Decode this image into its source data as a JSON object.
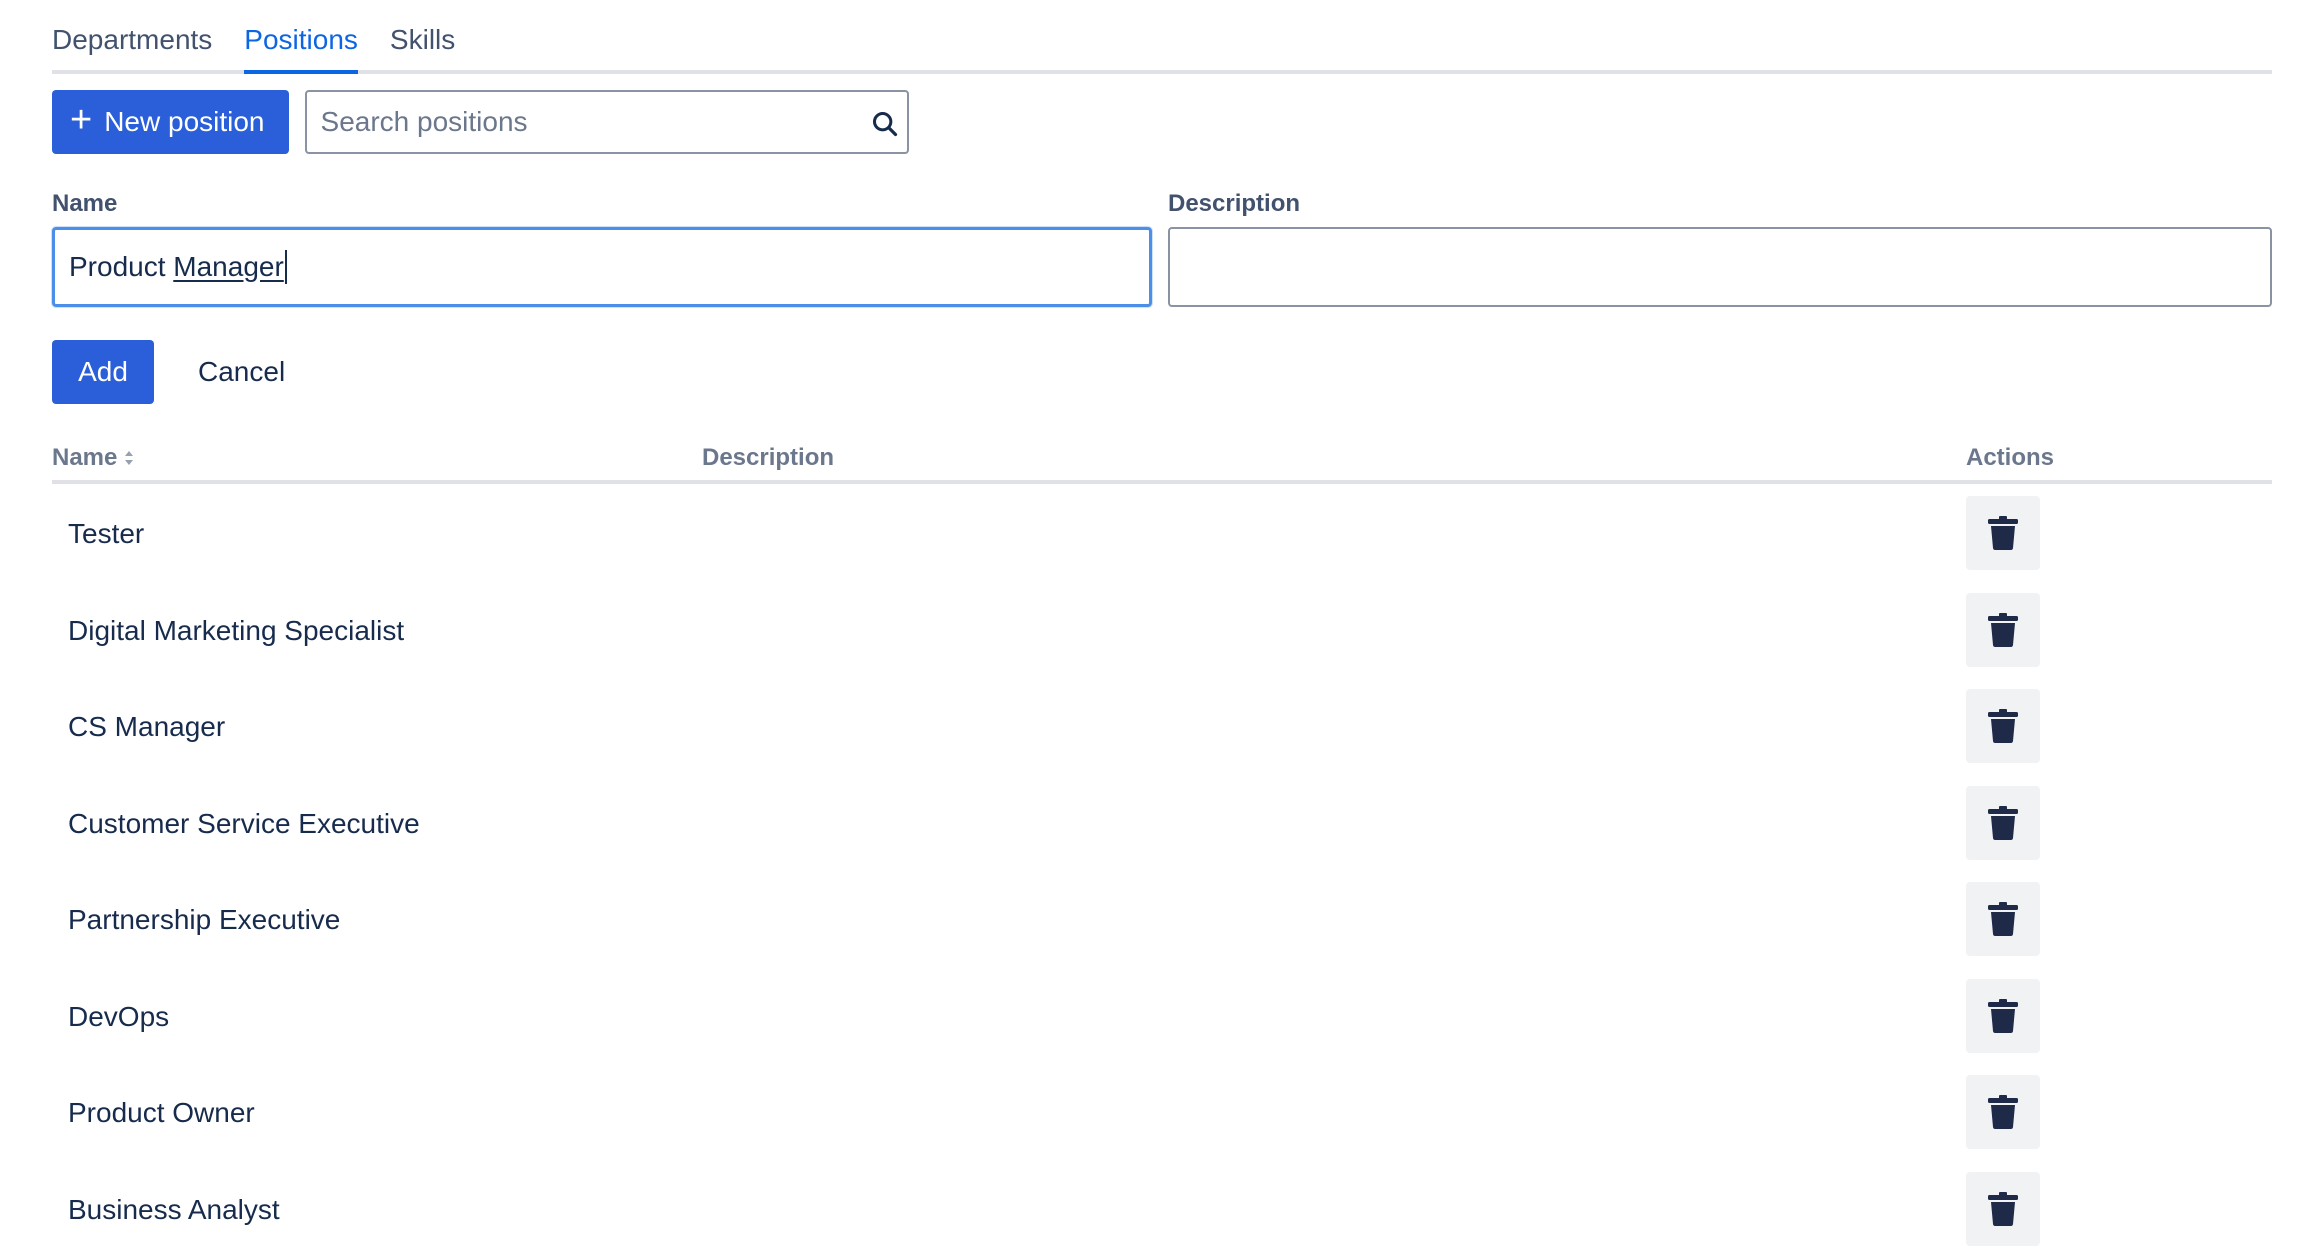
{
  "tabs": [
    {
      "label": "Departments",
      "active": false
    },
    {
      "label": "Positions",
      "active": true
    },
    {
      "label": "Skills",
      "active": false
    }
  ],
  "toolbar": {
    "new_button_label": "New position",
    "search_placeholder": "Search positions",
    "search_value": ""
  },
  "form": {
    "name_label": "Name",
    "name_value_prefix": "Product ",
    "name_value_word": "Manager",
    "description_label": "Description",
    "description_value": "",
    "add_label": "Add",
    "cancel_label": "Cancel"
  },
  "table": {
    "columns": {
      "name": "Name",
      "description": "Description",
      "actions": "Actions"
    },
    "rows": [
      {
        "name": "Tester",
        "description": ""
      },
      {
        "name": "Digital Marketing Specialist",
        "description": ""
      },
      {
        "name": "CS Manager",
        "description": ""
      },
      {
        "name": "Customer Service Executive",
        "description": ""
      },
      {
        "name": "Partnership Executive",
        "description": ""
      },
      {
        "name": "DevOps",
        "description": ""
      },
      {
        "name": "Product Owner",
        "description": ""
      },
      {
        "name": "Business Analyst",
        "description": ""
      }
    ]
  },
  "icons": {
    "new": "plus-icon",
    "search": "search-icon",
    "sort": "sort-icon",
    "delete": "trash-icon"
  },
  "colors": {
    "accent": "#2a5fd9",
    "active_tab": "#0c66e4",
    "text": "#172b4d",
    "muted": "#6b778c",
    "icon_dark": "#1e2a47",
    "button_subtle_bg": "#f1f2f4"
  }
}
